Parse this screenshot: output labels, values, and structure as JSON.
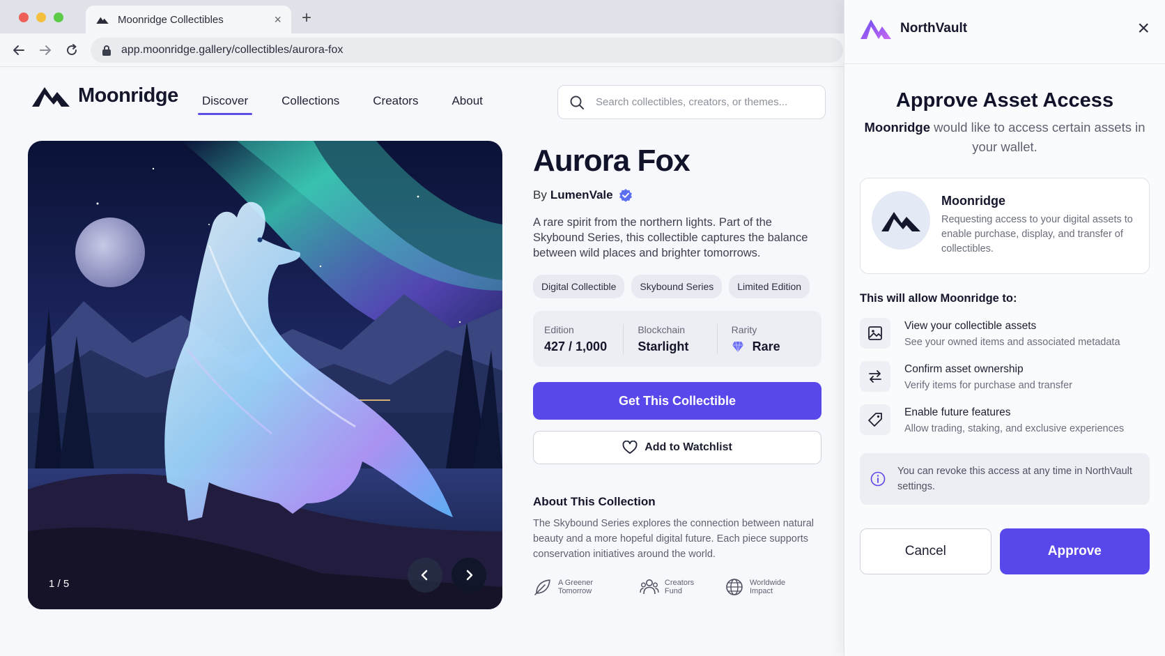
{
  "browser": {
    "tab_title": "Moonridge Collectibles",
    "tab_close": "×",
    "new_tab": "+",
    "url": "app.moonridge.gallery/collectibles/aurora-fox"
  },
  "site": {
    "brand": "Moonridge",
    "nav": [
      {
        "label": "Discover",
        "active": true
      },
      {
        "label": "Collections"
      },
      {
        "label": "Creators"
      },
      {
        "label": "About"
      }
    ],
    "search_placeholder": "Search collectibles, creators, or themes..."
  },
  "hero": {
    "counter": "1 / 5",
    "prev": "‹",
    "next": "›"
  },
  "item": {
    "title": "Aurora Fox",
    "by_prefix": "By",
    "author": "LumenVale",
    "description": "A rare spirit from the northern lights. Part of the Skybound Series, this collectible captures the balance between wild places and brighter tomorrows.",
    "tags": [
      "Digital Collectible",
      "Skybound Series",
      "Limited Edition"
    ],
    "stats": [
      {
        "label": "Edition",
        "value": "427 / 1,000"
      },
      {
        "label": "Blockchain",
        "value": "Starlight"
      },
      {
        "label": "Rarity",
        "value": "Rare"
      }
    ],
    "primary_cta": "Get This Collectible",
    "watchlist_cta": "Add to Watchlist",
    "about_title": "About This Collection",
    "about_text": "The Skybound Series explores the connection between natural beauty and a more hopeful digital future. Each piece supports conservation initiatives around the world.",
    "badges": [
      "A Greener Tomorrow",
      "Creators Fund",
      "Worldwide Impact"
    ]
  },
  "wallet": {
    "brand": "NorthVault",
    "close": "×",
    "title": "Approve Asset Access",
    "subtitle_site": "Moonridge",
    "subtitle_rest": " would like to access certain assets in your wallet.",
    "site_name": "Moonridge",
    "site_desc": "Requesting access to your digital assets to enable purchase, display, and transfer of collectibles.",
    "permissions_title": "This will allow Moonridge to:",
    "permissions": [
      {
        "name": "View your collectible assets",
        "desc": "See your owned items and associated metadata"
      },
      {
        "name": "Confirm asset ownership",
        "desc": "Verify items for purchase and transfer"
      },
      {
        "name": "Enable future features",
        "desc": "Allow trading, staking, and exclusive experiences"
      }
    ],
    "info": "You can revoke this access at any time in NorthVault settings.",
    "cancel": "Cancel",
    "approve": "Approve"
  },
  "colors": {
    "accent": "#5847ea",
    "verified": "#5b6ef0",
    "text": "#14162b"
  }
}
